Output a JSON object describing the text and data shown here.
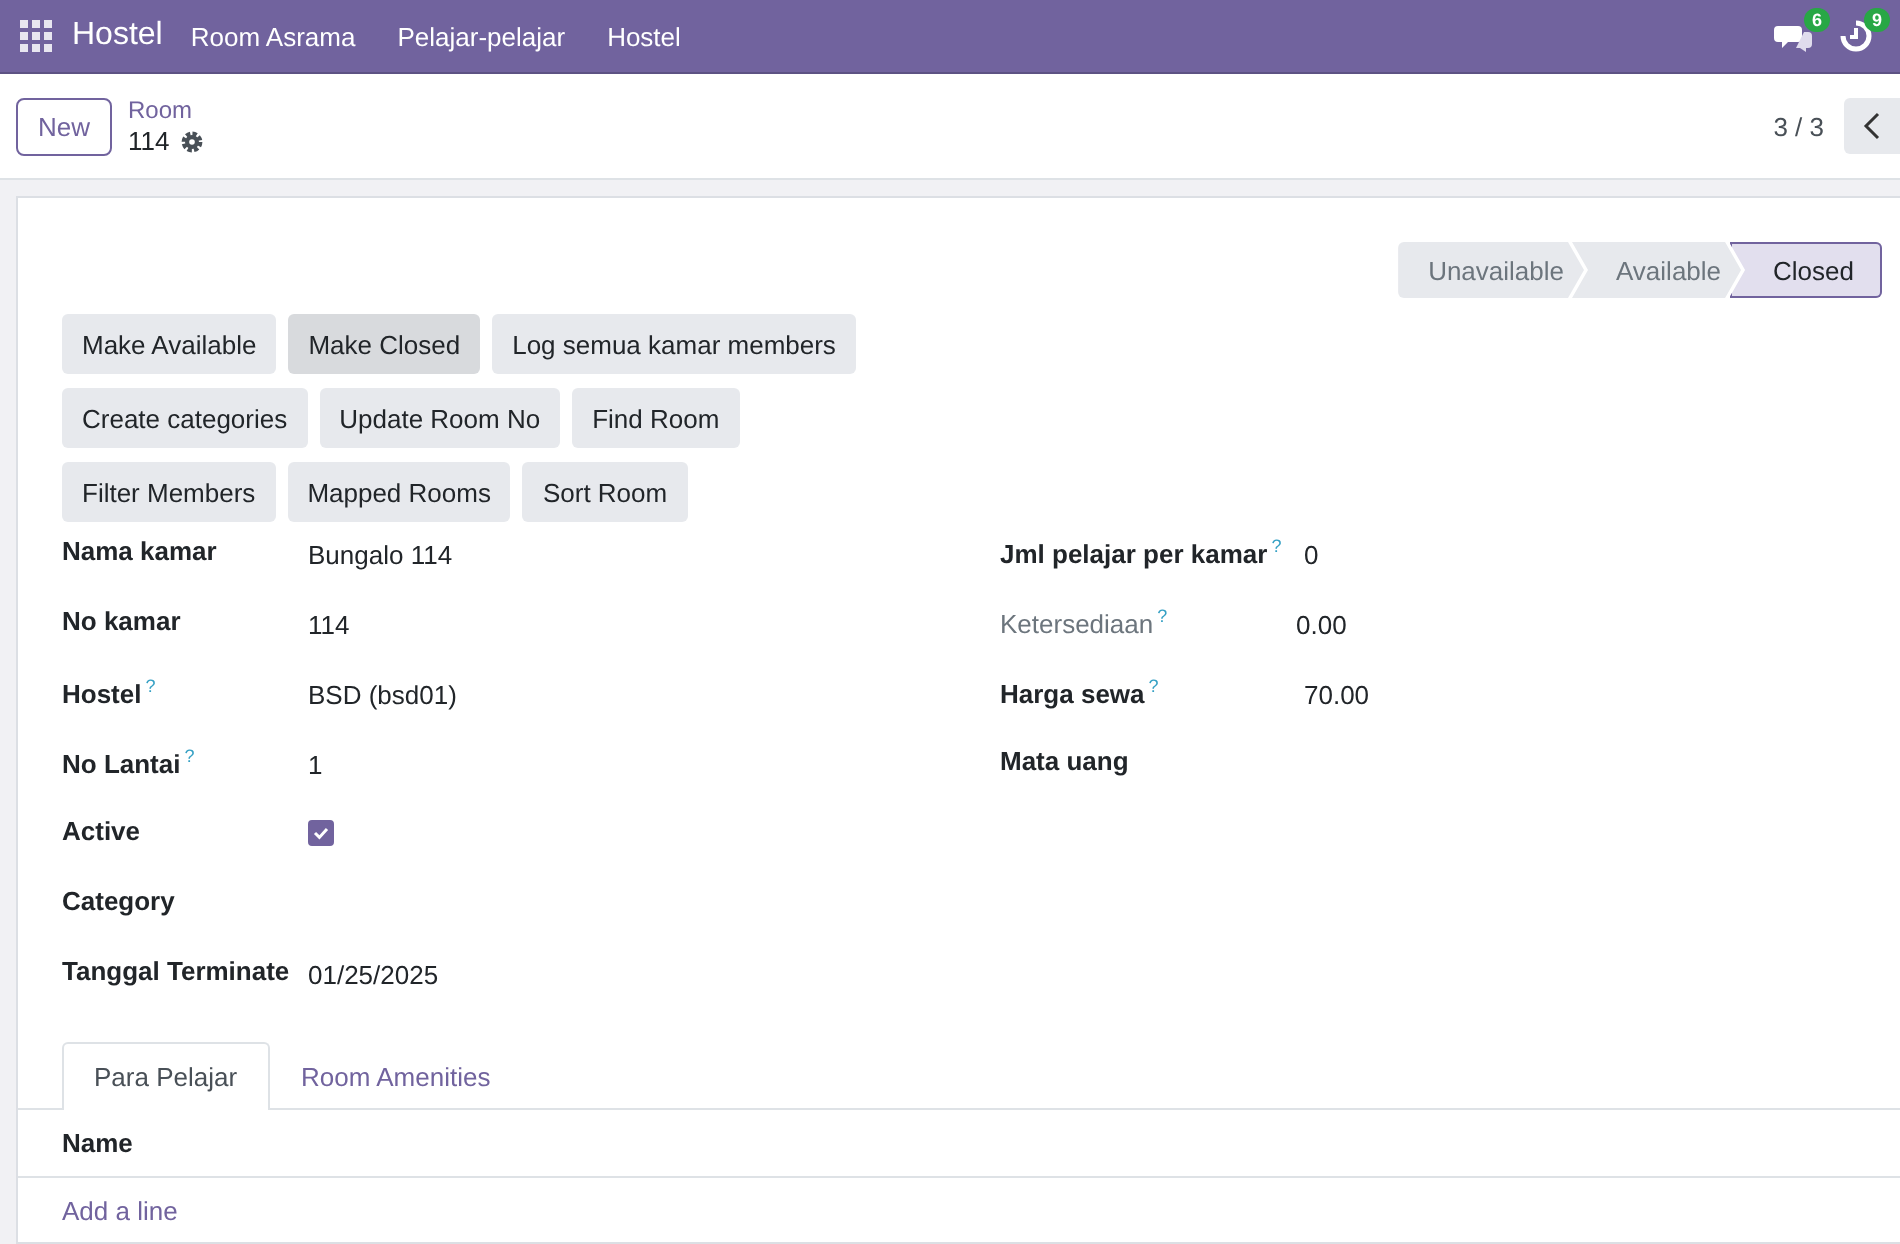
{
  "navbar": {
    "app_name": "Hostel",
    "menu": [
      "Room Asrama",
      "Pelajar-pelajar",
      "Hostel"
    ],
    "messages_count": "6",
    "activities_count": "9"
  },
  "control_panel": {
    "new_button": "New",
    "breadcrumb": "Room",
    "record_name": "114",
    "pager": "3 / 3"
  },
  "statusbar": [
    {
      "label": "Unavailable",
      "selected": false
    },
    {
      "label": "Available",
      "selected": false
    },
    {
      "label": "Closed",
      "selected": true
    }
  ],
  "action_buttons": [
    [
      {
        "label": "Make Available",
        "highlighted": false
      },
      {
        "label": "Make Closed",
        "highlighted": true
      },
      {
        "label": "Log semua kamar members",
        "highlighted": false
      }
    ],
    [
      {
        "label": "Create categories",
        "highlighted": false
      },
      {
        "label": "Update Room No",
        "highlighted": false
      },
      {
        "label": "Find Room",
        "highlighted": false
      }
    ],
    [
      {
        "label": "Filter Members",
        "highlighted": false
      },
      {
        "label": "Mapped Rooms",
        "highlighted": false
      },
      {
        "label": "Sort Room",
        "highlighted": false
      }
    ]
  ],
  "left_fields": [
    {
      "kind": "text",
      "label": "Nama kamar",
      "value": "Bungalo 114"
    },
    {
      "kind": "text",
      "label": "No kamar",
      "value": "114"
    },
    {
      "kind": "text",
      "label": "Hostel",
      "help": "?",
      "value": "BSD (bsd01)"
    },
    {
      "kind": "text",
      "label": "No Lantai",
      "help": "?",
      "value": "1"
    },
    {
      "kind": "checkbox",
      "label": "Active",
      "checked": true
    },
    {
      "kind": "empty",
      "label": "Category"
    },
    {
      "kind": "text",
      "label": "Tanggal Terminate",
      "value": "01/25/2025"
    }
  ],
  "right_fields": [
    {
      "kind": "text",
      "label": "Jml pelajar per kamar",
      "help": "?",
      "readonly": false,
      "value": "0"
    },
    {
      "kind": "text",
      "label": "Ketersediaan",
      "help": "?",
      "readonly": true,
      "value": "0.00"
    },
    {
      "kind": "text",
      "label": "Harga sewa",
      "help": "?",
      "readonly": false,
      "value": "70.00"
    },
    {
      "kind": "empty",
      "label": "Mata uang",
      "readonly": false
    }
  ],
  "notebook": {
    "tabs": [
      {
        "label": "Para Pelajar",
        "selected": true
      },
      {
        "label": "Room Amenities",
        "selected": false
      }
    ],
    "columns": [
      "Name"
    ],
    "add_line": "Add a line"
  }
}
